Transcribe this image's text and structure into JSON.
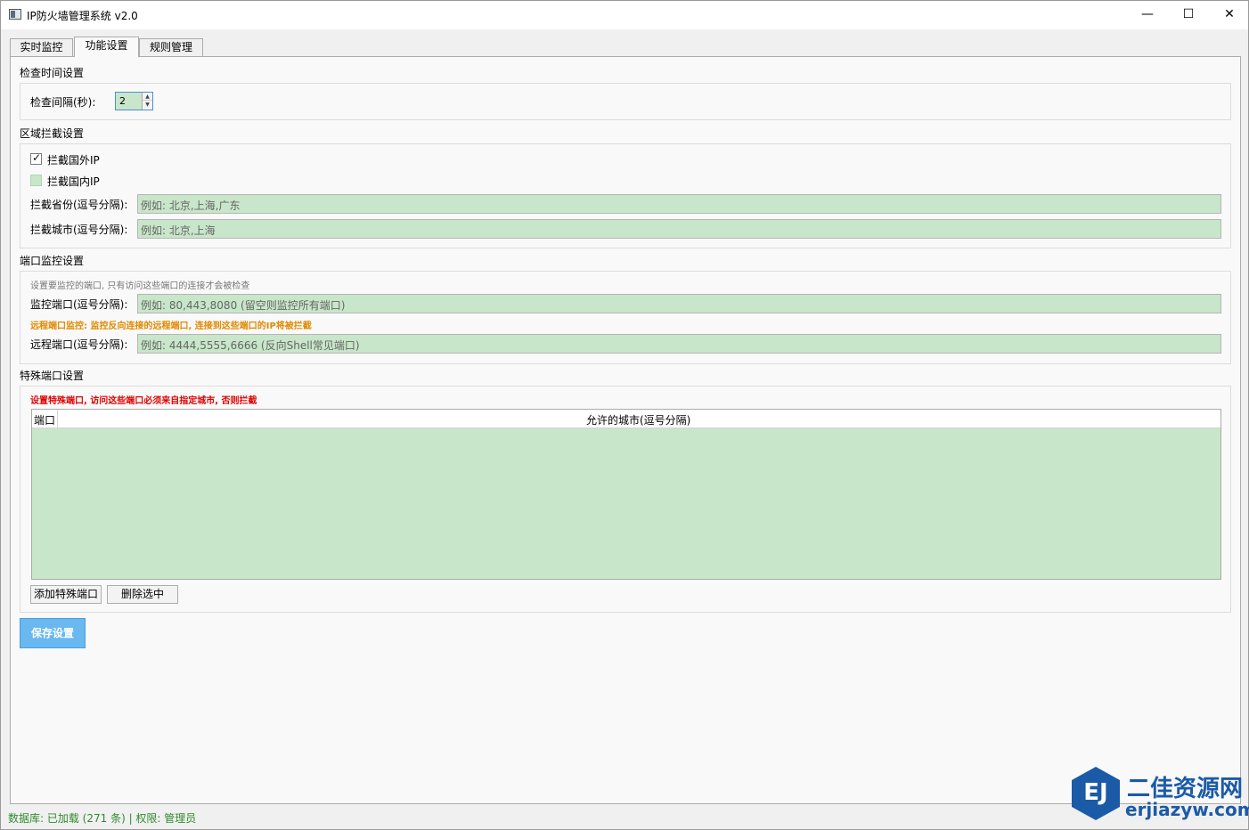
{
  "window": {
    "title": "IP防火墙管理系统 v2.0",
    "minimize": "—",
    "maximize": "☐",
    "close": "✕"
  },
  "tabs": [
    {
      "label": "实时监控",
      "active": false
    },
    {
      "label": "功能设置",
      "active": true
    },
    {
      "label": "规则管理",
      "active": false
    }
  ],
  "check_time": {
    "section_title": "检查时间设置",
    "interval_label": "检查间隔(秒):",
    "interval_value": "2"
  },
  "region_block": {
    "section_title": "区域拦截设置",
    "block_foreign_label": "拦截国外IP",
    "block_foreign_checked": true,
    "block_domestic_label": "拦截国内IP",
    "block_domestic_checked": false,
    "province_label": "拦截省份(逗号分隔):",
    "province_placeholder": "例如: 北京,上海,广东",
    "city_label": "拦截城市(逗号分隔):",
    "city_placeholder": "例如: 北京,上海"
  },
  "port_monitor": {
    "section_title": "端口监控设置",
    "hint": "设置要监控的端口, 只有访问这些端口的连接才会被检查",
    "monitor_label": "监控端口(逗号分隔):",
    "monitor_placeholder": "例如: 80,443,8080 (留空则监控所有端口)",
    "remote_warning": "远程端口监控: 监控反向连接的远程端口, 连接到这些端口的IP将被拦截",
    "remote_label": "远程端口(逗号分隔):",
    "remote_placeholder": "例如: 4444,5555,6666 (反向Shell常见端口)"
  },
  "special_port": {
    "section_title": "特殊端口设置",
    "warning": "设置特殊端口, 访问这些端口必须来自指定城市, 否则拦截",
    "columns": [
      "端口",
      "允许的城市(逗号分隔)"
    ],
    "rows": [],
    "add_button": "添加特殊端口",
    "delete_button": "删除选中"
  },
  "save_button": "保存设置",
  "statusbar": {
    "text": "数据库: 已加载 (271 条) | 权限: 管理员"
  },
  "watermark": {
    "logo": "EJ",
    "cn": "二佳资源网",
    "en": "erjiazyw.com"
  },
  "colors": {
    "input_bg": "#c8e6c9",
    "save_button_bg": "#69b8f0",
    "warn_orange": "#e08a00",
    "warn_red": "#e00000",
    "status_green": "#2e8b2e"
  }
}
